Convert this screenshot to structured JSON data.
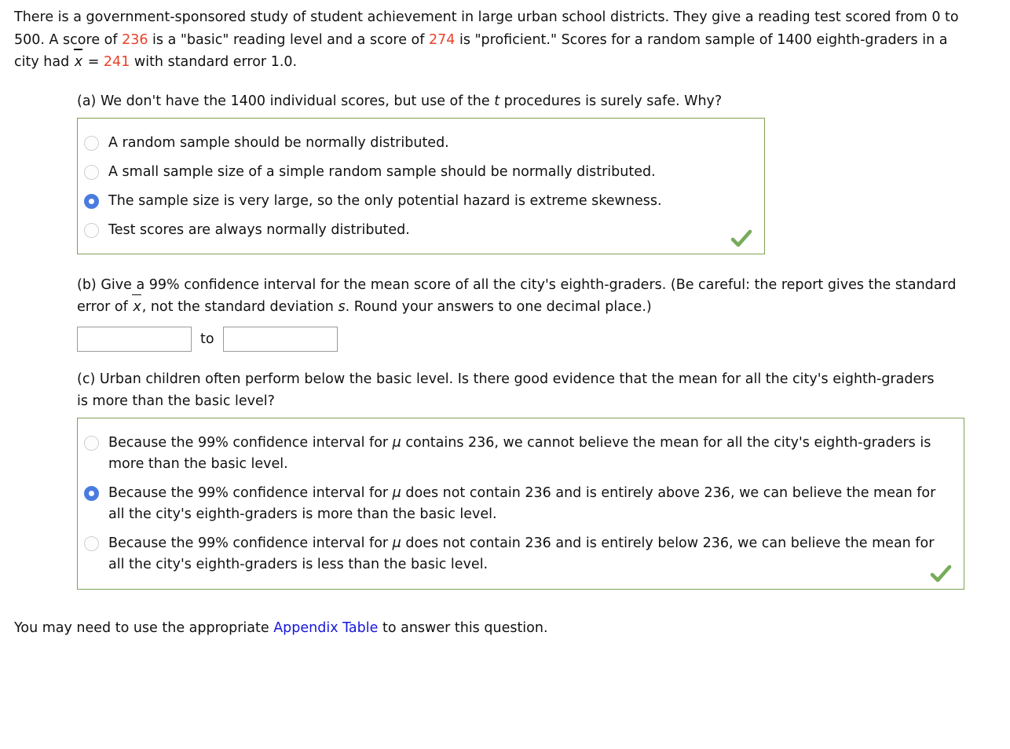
{
  "intro": {
    "line1_pre": "There is a government-sponsored study of student achievement in large urban school districts. They give a reading test scored from 0 to 500. A score of ",
    "basic_score": "236",
    "mid1": " is a \"basic\" reading level and a score of ",
    "proficient_score": "274",
    "mid2": " is \"proficient.\" Scores for a random sample of 1400 eighth-graders in a city had ",
    "xbar_symbol": "x",
    "equals": " = ",
    "xbar_value": "241",
    "tail": " with standard error 1.0."
  },
  "part_a": {
    "label": "(a)",
    "prompt_pre": "We don't have the 1400 individual scores, but use of the ",
    "prompt_italic": "t",
    "prompt_post": " procedures is surely safe. Why?",
    "options": [
      {
        "text": "A random sample should be normally distributed.",
        "selected": false
      },
      {
        "text": "A small sample size of a simple random sample should be normally distributed.",
        "selected": false
      },
      {
        "text": "The sample size is very large, so the only potential hazard is extreme skewness.",
        "selected": true
      },
      {
        "text": "Test scores are always normally distributed.",
        "selected": false
      }
    ],
    "status": "correct",
    "status_icon": "green-check-icon"
  },
  "part_b": {
    "label": "(b)",
    "prompt_pre": "Give a 99% confidence interval for the mean score of all the city's eighth-graders. (Be careful: the report gives the standard error of ",
    "xbar_symbol": "x",
    "prompt_mid": ", not the standard deviation ",
    "s_symbol": "s",
    "prompt_post": ". Round your answers to one decimal place.)",
    "lower_value": "",
    "lower_placeholder": "",
    "separator": "to",
    "upper_value": "",
    "upper_placeholder": ""
  },
  "part_c": {
    "label": "(c)",
    "prompt": "Urban children often perform below the basic level. Is there good evidence that the mean for all the city's eighth-graders is more than the basic level?",
    "options": [
      {
        "pre": "Because the 99% confidence interval for ",
        "mu": "μ",
        "post": " contains 236, we cannot believe the mean for all the city's eighth-graders is more than the basic level.",
        "selected": false
      },
      {
        "pre": "Because the 99% confidence interval for ",
        "mu": "μ",
        "post": " does not contain 236 and is entirely above 236, we can believe the mean for all the city's eighth-graders is more than the basic level.",
        "selected": true
      },
      {
        "pre": "Because the 99% confidence interval for ",
        "mu": "μ",
        "post": " does not contain 236 and is entirely below 236, we can believe the mean for all the city's eighth-graders is less than the basic level.",
        "selected": false
      }
    ],
    "status": "correct",
    "status_icon": "green-check-icon"
  },
  "footer": {
    "pre": "You may need to use the appropriate ",
    "link_text": "Appendix Table",
    "post": " to answer this question."
  },
  "colors": {
    "highlight_red": "#e8422a",
    "answer_box_border": "#7fa055",
    "radio_selected": "#4a7ce0",
    "radio_unselected": "#cfcfcf",
    "check_green": "#76ab5a",
    "link_blue": "#1717d8",
    "input_border": "#9a9a9a"
  }
}
